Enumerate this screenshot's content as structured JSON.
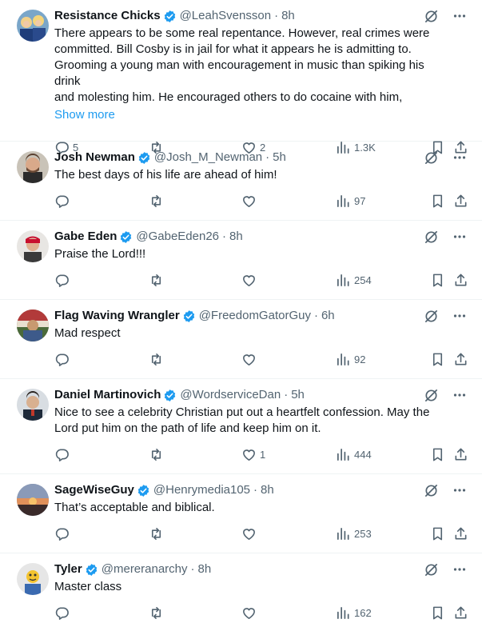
{
  "replies": [
    {
      "name": "Resistance Chicks",
      "handle": "@LeahSvensson",
      "time": "8h",
      "lines": [
        "There appears to be some real repentance.  However, real crimes were",
        "committed. Bill Cosby is in jail for what it appears he is admitting to.",
        "Grooming a young man with encouragement in music than spiking his drink",
        "and molesting him. He encouraged others to do cocaine with him,"
      ],
      "show_more": "Show more",
      "reply_count": "5",
      "retweet_count": "",
      "like_count": "2",
      "views": "1.3K"
    },
    {
      "name": "Josh Newman",
      "handle": "@Josh_M_Newman",
      "time": "5h",
      "lines": [
        "The best days of his life are ahead of him!"
      ],
      "reply_count": "",
      "retweet_count": "",
      "like_count": "",
      "views": "97"
    },
    {
      "name": "Gabe Eden",
      "handle": "@GabeEden26",
      "time": "8h",
      "lines": [
        "Praise the Lord!!!"
      ],
      "reply_count": "",
      "retweet_count": "",
      "like_count": "",
      "views": "254"
    },
    {
      "name": "Flag Waving Wrangler",
      "handle": "@FreedomGatorGuy",
      "time": "6h",
      "lines": [
        "Mad respect"
      ],
      "reply_count": "",
      "retweet_count": "",
      "like_count": "",
      "views": "92"
    },
    {
      "name": "Daniel Martinovich",
      "handle": "@WordserviceDan",
      "time": "5h",
      "lines": [
        "Nice to see a celebrity Christian put out a heartfelt confession. May the",
        "Lord put him on the path of life and keep him on it."
      ],
      "reply_count": "",
      "retweet_count": "",
      "like_count": "1",
      "views": "444"
    },
    {
      "name": "SageWiseGuy",
      "handle": "@Henrymedia105",
      "time": "8h",
      "lines": [
        "That’s acceptable and biblical."
      ],
      "reply_count": "",
      "retweet_count": "",
      "like_count": "",
      "views": "253"
    },
    {
      "name": "Tyler",
      "handle": "@mereranarchy",
      "time": "8h",
      "lines": [
        "Master class"
      ],
      "reply_count": "",
      "retweet_count": "",
      "like_count": "",
      "views": "162"
    }
  ],
  "separator": "·",
  "colors": {
    "text": "#0f1419",
    "secondary": "#536471",
    "accent": "#1d9bf0",
    "divider": "#eff3f4"
  },
  "icons": [
    "verified-badge-icon",
    "grok-icon",
    "more-icon",
    "reply-icon",
    "retweet-icon",
    "like-icon",
    "views-icon",
    "bookmark-icon",
    "share-icon"
  ]
}
